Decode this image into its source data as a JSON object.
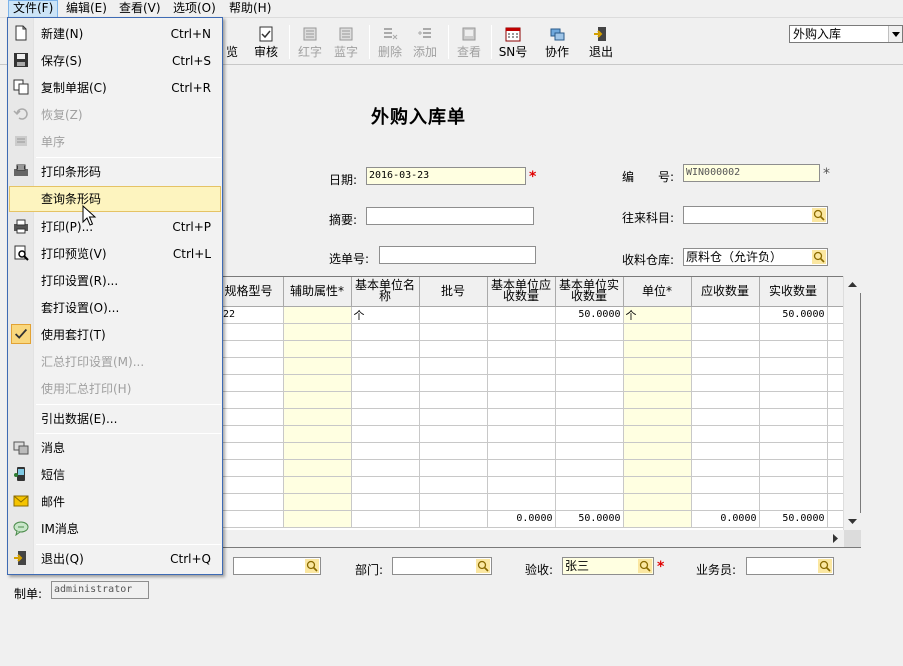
{
  "menubar": {
    "items": [
      {
        "label": "文件(F)"
      },
      {
        "label": "编辑(E)"
      },
      {
        "label": "查看(V)"
      },
      {
        "label": "选项(O)"
      },
      {
        "label": "帮助(H)"
      }
    ]
  },
  "toolbar": {
    "buttons": [
      {
        "label": "览"
      },
      {
        "label": "审核"
      },
      {
        "label": "红字"
      },
      {
        "label": "蓝字"
      },
      {
        "label": "删除"
      },
      {
        "label": "添加"
      },
      {
        "label": "查看"
      },
      {
        "label": "SN号"
      },
      {
        "label": "协作"
      },
      {
        "label": "退出"
      }
    ],
    "doc_type_select": {
      "value": "外购入库"
    }
  },
  "form": {
    "title": "外购入库单",
    "date": {
      "label": "日期:",
      "value": "2016-03-23"
    },
    "number": {
      "label": "编　　号:",
      "value": "WIN000002"
    },
    "summary": {
      "label": "摘要:",
      "value": ""
    },
    "account": {
      "label": "往来科目:",
      "value": ""
    },
    "select_no": {
      "label": "选单号:",
      "value": ""
    },
    "warehouse": {
      "label": "收料仓库:",
      "value": "原料仓（允许负）"
    },
    "department": {
      "label": "部门:",
      "value": ""
    },
    "inspector": {
      "label": "验收:",
      "value": "张三"
    },
    "salesman": {
      "label": "业务员:",
      "value": ""
    },
    "maker": {
      "label": "制单:",
      "value": "administrator"
    },
    "unlabeled_lookup": {
      "value": ""
    }
  },
  "grid": {
    "columns": [
      "规格型号",
      "辅助属性*",
      "基本单位名称",
      "批号",
      "基本单位应收数量",
      "基本单位实收数量",
      "单位*",
      "应收数量",
      "实收数量"
    ],
    "rows": [
      [
        "22",
        "",
        "个",
        "",
        "",
        "50.0000",
        "个",
        "",
        "50.0000"
      ]
    ],
    "totals": [
      "",
      "",
      "",
      "",
      "0.0000",
      "50.0000",
      "",
      "0.0000",
      "50.0000"
    ]
  },
  "file_menu": {
    "items": [
      {
        "label": "新建(N)",
        "shortcut": "Ctrl+N"
      },
      {
        "label": "保存(S)",
        "shortcut": "Ctrl+S"
      },
      {
        "label": "复制单据(C)",
        "shortcut": "Ctrl+R"
      },
      {
        "label": "恢复(Z)",
        "shortcut": ""
      },
      {
        "label": "单序",
        "shortcut": ""
      },
      {
        "label": "打印条形码",
        "shortcut": ""
      },
      {
        "label": "查询条形码",
        "shortcut": ""
      },
      {
        "label": "打印(P)...",
        "shortcut": "Ctrl+P"
      },
      {
        "label": "打印预览(V)",
        "shortcut": "Ctrl+L"
      },
      {
        "label": "打印设置(R)...",
        "shortcut": ""
      },
      {
        "label": "套打设置(O)...",
        "shortcut": ""
      },
      {
        "label": "使用套打(T)",
        "shortcut": ""
      },
      {
        "label": "汇总打印设置(M)...",
        "shortcut": ""
      },
      {
        "label": "使用汇总打印(H)",
        "shortcut": ""
      },
      {
        "label": "引出数据(E)...",
        "shortcut": ""
      },
      {
        "label": "消息",
        "shortcut": ""
      },
      {
        "label": "短信",
        "shortcut": ""
      },
      {
        "label": "邮件",
        "shortcut": ""
      },
      {
        "label": "IM消息",
        "shortcut": ""
      },
      {
        "label": "退出(Q)",
        "shortcut": "Ctrl+Q"
      }
    ]
  }
}
